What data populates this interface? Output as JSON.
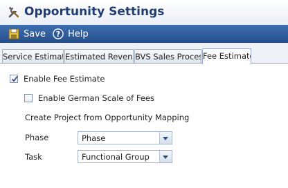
{
  "window": {
    "title": "Opportunity Settings"
  },
  "toolbar": {
    "save_label": "Save",
    "help_label": "Help"
  },
  "tabs": [
    {
      "label": "Service Estimate",
      "active": false
    },
    {
      "label": "Estimated Revenue",
      "active": false
    },
    {
      "label": "BVS Sales Process",
      "active": false
    },
    {
      "label": "Fee Estimate",
      "active": true
    }
  ],
  "form": {
    "enable_fee_estimate": {
      "label": "Enable Fee Estimate",
      "checked": true
    },
    "enable_german_scale": {
      "label": "Enable German Scale of Fees",
      "checked": false
    },
    "mapping_heading": "Create Project from Opportunity Mapping",
    "phase": {
      "label": "Phase",
      "value": "Phase"
    },
    "task": {
      "label": "Task",
      "value": "Functional Group"
    }
  },
  "colors": {
    "toolbar": "#2f5c9c",
    "title": "#1f3d73",
    "accent": "#3f6fb0"
  }
}
